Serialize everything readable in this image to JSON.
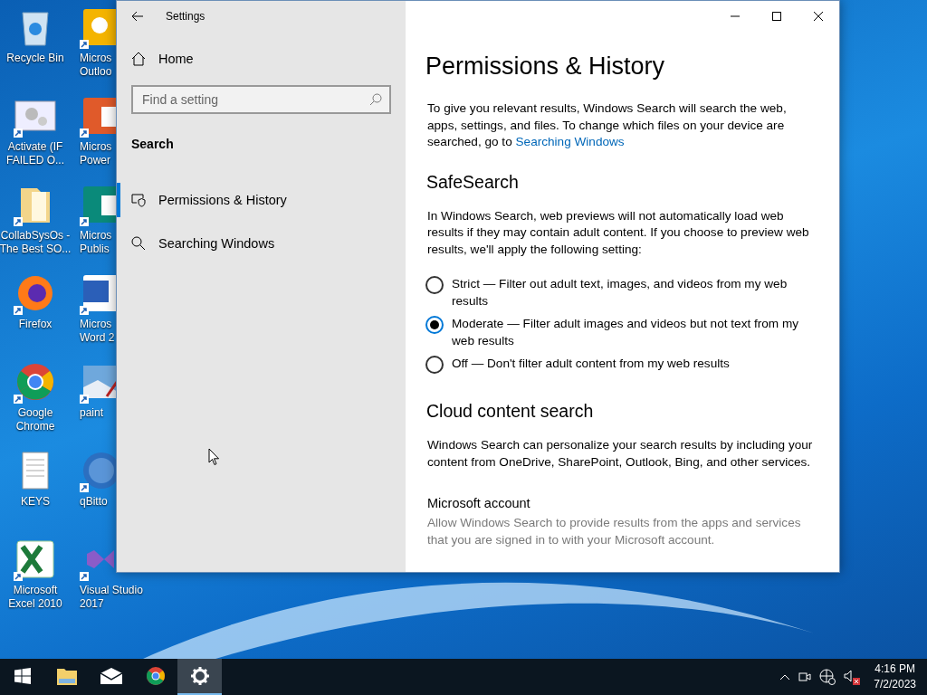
{
  "desktop": {
    "icons": [
      {
        "label": "Recycle Bin",
        "kind": "recycle",
        "shortcut": false
      },
      {
        "label": "Micros\nOutloo",
        "kind": "outlook",
        "shortcut": true
      },
      {
        "label": "Activate (IF\nFAILED O...",
        "kind": "gears",
        "shortcut": true
      },
      {
        "label": "Micros\nPower",
        "kind": "powerpoint",
        "shortcut": true
      },
      {
        "label": "CollabSysOs -\nThe Best SO...",
        "kind": "folder",
        "shortcut": true
      },
      {
        "label": "Micros\nPublis",
        "kind": "publisher",
        "shortcut": true
      },
      {
        "label": "Firefox",
        "kind": "firefox",
        "shortcut": true
      },
      {
        "label": "Micros\nWord 2",
        "kind": "word",
        "shortcut": true
      },
      {
        "label": "Google\nChrome",
        "kind": "chrome",
        "shortcut": true
      },
      {
        "label": "paint",
        "kind": "paint",
        "shortcut": true
      },
      {
        "label": "KEYS",
        "kind": "text",
        "shortcut": false
      },
      {
        "label": "qBitto",
        "kind": "qbit",
        "shortcut": true
      },
      {
        "label": "Microsoft\nExcel 2010",
        "kind": "excel",
        "shortcut": true
      },
      {
        "label": "Visual Studio\n2017",
        "kind": "vs",
        "shortcut": true
      }
    ]
  },
  "window": {
    "title": "Settings",
    "sidebar": {
      "home": "Home",
      "search_placeholder": "Find a setting",
      "section": "Search",
      "items": [
        {
          "label": "Permissions & History",
          "selected": true
        },
        {
          "label": "Searching Windows",
          "selected": false
        }
      ]
    },
    "content": {
      "title": "Permissions & History",
      "intro": "To give you relevant results, Windows Search will search the web, apps, settings, and files. To change which files on your device are searched, go to ",
      "intro_link": "Searching Windows",
      "safesearch": {
        "heading": "SafeSearch",
        "text": "In Windows Search, web previews will not automatically load web results if they may contain adult content. If you choose to preview web results, we'll apply the following setting:",
        "options": [
          {
            "label": "Strict — Filter out adult text, images, and videos from my web results",
            "selected": false
          },
          {
            "label": "Moderate — Filter adult images and videos but not text from my web results",
            "selected": true
          },
          {
            "label": "Off — Don't filter adult content from my web results",
            "selected": false
          }
        ]
      },
      "cloud": {
        "heading": "Cloud content search",
        "text": "Windows Search can personalize your search results by including your content from OneDrive, SharePoint, Outlook, Bing, and other services.",
        "account_heading": "Microsoft account",
        "account_text": "Allow Windows Search to provide results from the apps and services that you are signed in to with your Microsoft account."
      }
    }
  },
  "taskbar": {
    "apps": [
      {
        "kind": "explorer",
        "active": false
      },
      {
        "kind": "mail",
        "active": false
      },
      {
        "kind": "chrome",
        "active": false
      },
      {
        "kind": "settings",
        "active": true
      }
    ],
    "time": "4:16 PM",
    "date": "7/2/2023"
  }
}
